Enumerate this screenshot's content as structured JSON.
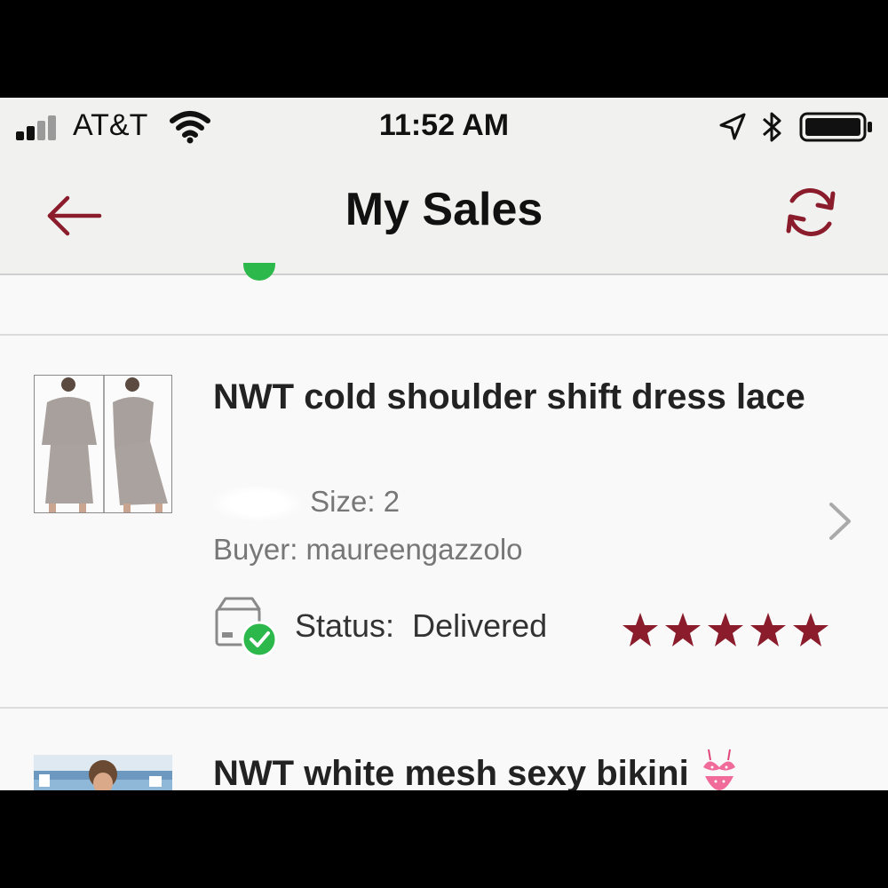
{
  "status_bar": {
    "carrier": "AT&T",
    "time": "11:52 AM",
    "icons": [
      "signal-icon",
      "wifi-icon",
      "location-arrow-icon",
      "bluetooth-icon",
      "battery-icon"
    ]
  },
  "nav": {
    "title": "My Sales",
    "back_icon": "back-arrow-icon",
    "refresh_icon": "refresh-icon"
  },
  "colors": {
    "accent": "#8b1c2c",
    "success": "#2db84b",
    "text_primary": "#222222",
    "text_secondary": "#777777"
  },
  "sales": [
    {
      "title": "NWT cold shoulder shift dress lace",
      "size_label": "Size:",
      "size_value": "2",
      "buyer_label": "Buyer:",
      "buyer": "maureengazzolo",
      "status_label": "Status:",
      "status": "Delivered",
      "rating": 5
    },
    {
      "title": "NWT white mesh sexy bikini",
      "title_emoji": "bikini-emoji"
    }
  ]
}
